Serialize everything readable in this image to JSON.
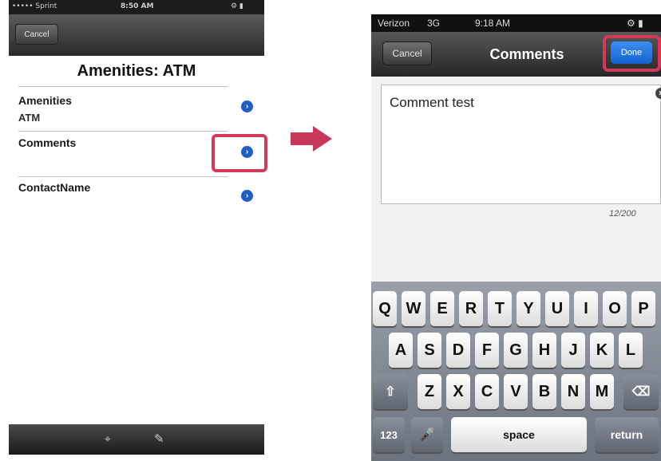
{
  "left": {
    "status_bar": {
      "carrier": "••••• Sprint",
      "time": "8:50 AM"
    },
    "nav": {
      "cancel_label": "Cancel"
    },
    "title": "Amenities: ATM",
    "fields": [
      {
        "label": "Amenities",
        "value": "ATM"
      },
      {
        "label": "Comments",
        "value": ""
      },
      {
        "label": "ContactName",
        "value": ""
      }
    ]
  },
  "right": {
    "status_bar": {
      "carrier": "Verizon",
      "network": "3G",
      "time": "9:18 AM"
    },
    "nav": {
      "cancel_label": "Cancel",
      "title": "Comments",
      "done_label": "Done"
    },
    "comment_text": "Comment test",
    "char_count": "12/200",
    "keyboard": {
      "row1": [
        "Q",
        "W",
        "E",
        "R",
        "T",
        "Y",
        "U",
        "I",
        "O",
        "P"
      ],
      "row2": [
        "A",
        "S",
        "D",
        "F",
        "G",
        "H",
        "J",
        "K",
        "L"
      ],
      "row3": [
        "Z",
        "X",
        "C",
        "V",
        "B",
        "N",
        "M"
      ],
      "num_label": "123",
      "space_label": "space",
      "return_label": "return"
    }
  },
  "colors": {
    "highlight": "#d23a5a",
    "disclosure": "#1f5fbf",
    "done_button": "#1e6fe0"
  }
}
